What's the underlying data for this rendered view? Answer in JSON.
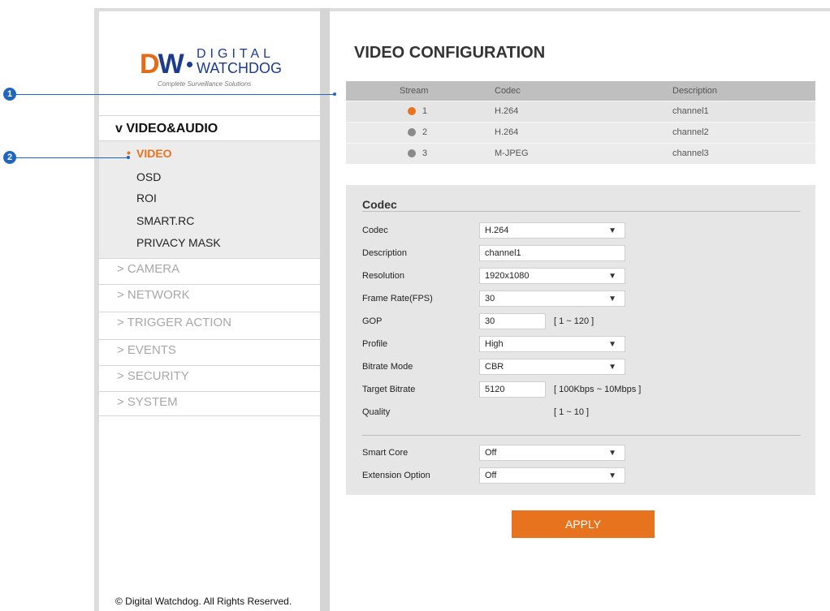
{
  "brand": {
    "logo_mark": "DW",
    "logo_word1": "DIGITAL",
    "logo_word2": "WATCHDOG",
    "tagline": "Complete Surveillance Solutions"
  },
  "sidebar": {
    "section_label": "v VIDEO&AUDIO",
    "subitems": [
      "VIDEO",
      "OSD",
      "ROI",
      "SMART.RC",
      "PRIVACY MASK"
    ],
    "active_subitem": "VIDEO",
    "categories": [
      "> CAMERA",
      "> NETWORK",
      "> TRIGGER ACTION",
      "> EVENTS",
      "> SECURITY",
      "> SYSTEM"
    ],
    "copyright": "© Digital Watchdog. All Rights Reserved."
  },
  "main": {
    "title": "VIDEO CONFIGURATION",
    "stream_table": {
      "headers": [
        "Stream",
        "Codec",
        "Description"
      ],
      "rows": [
        {
          "stream": "1",
          "codec": "H.264",
          "description": "channel1",
          "active": true
        },
        {
          "stream": "2",
          "codec": "H.264",
          "description": "channel2",
          "active": false
        },
        {
          "stream": "3",
          "codec": "M-JPEG",
          "description": "channel3",
          "active": false
        }
      ]
    },
    "codec_panel": {
      "title": "Codec",
      "fields": {
        "codec": {
          "label": "Codec",
          "value": "H.264"
        },
        "description": {
          "label": "Description",
          "value": "channel1"
        },
        "resolution": {
          "label": "Resolution",
          "value": "1920x1080"
        },
        "frame_rate": {
          "label": "Frame Rate(FPS)",
          "value": "30"
        },
        "gop": {
          "label": "GOP",
          "value": "30",
          "range": "[ 1 ~ 120 ]"
        },
        "profile": {
          "label": "Profile",
          "value": "High"
        },
        "bitrate_mode": {
          "label": "Bitrate Mode",
          "value": "CBR"
        },
        "target_bitrate": {
          "label": "Target Bitrate",
          "value": "5120",
          "range": "[ 100Kbps ~ 10Mbps ]"
        },
        "quality": {
          "label": "Quality",
          "value": "",
          "range": "[ 1 ~ 10 ]"
        },
        "smart_core": {
          "label": "Smart Core",
          "value": "Off"
        },
        "extension_option": {
          "label": "Extension Option",
          "value": "Off"
        }
      }
    },
    "apply_label": "APPLY"
  },
  "callouts": [
    "1",
    "2"
  ],
  "colors": {
    "accent": "#e8731f",
    "callout": "#1f66c2",
    "brand_blue": "#1b3c8c"
  }
}
